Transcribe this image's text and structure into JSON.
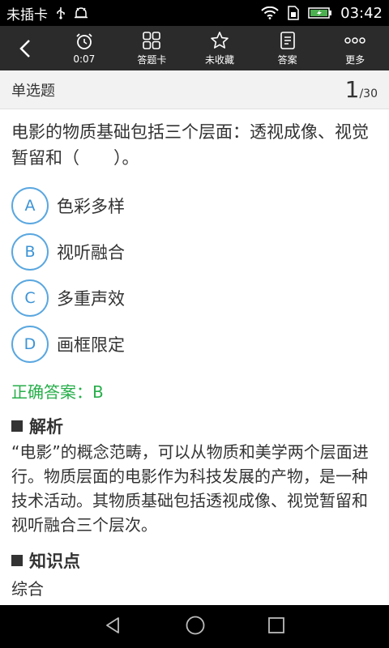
{
  "status_bar": {
    "carrier": "未插卡",
    "time": "03:42"
  },
  "toolbar": {
    "timer_label": "0:07",
    "card_label": "答题卡",
    "favorite_label": "未收藏",
    "answer_label": "答案",
    "more_label": "更多"
  },
  "header": {
    "question_type": "单选题",
    "current": "1",
    "total": "/30"
  },
  "question": {
    "text": "电影的物质基础包括三个层面：透视成像、视觉暂留和（　　）。",
    "options": [
      {
        "letter": "A",
        "text": "色彩多样"
      },
      {
        "letter": "B",
        "text": "视听融合"
      },
      {
        "letter": "C",
        "text": "多重声效"
      },
      {
        "letter": "D",
        "text": "画框限定"
      }
    ],
    "correct_answer": "正确答案：B"
  },
  "analysis": {
    "title": "解析",
    "text": "“电影”的概念范畴，可以从物质和美学两个层面进行。物质层面的电影作为科技发展的产物，是一种技术活动。其物质基础包括透视成像、视觉暂留和视听融合三个层次。"
  },
  "knowledge": {
    "title": "知识点",
    "text": "综合"
  },
  "colors": {
    "toolbar_bg": "#2b2b2b",
    "option_accent": "#3c93d6",
    "correct_green": "#27ae4a"
  }
}
